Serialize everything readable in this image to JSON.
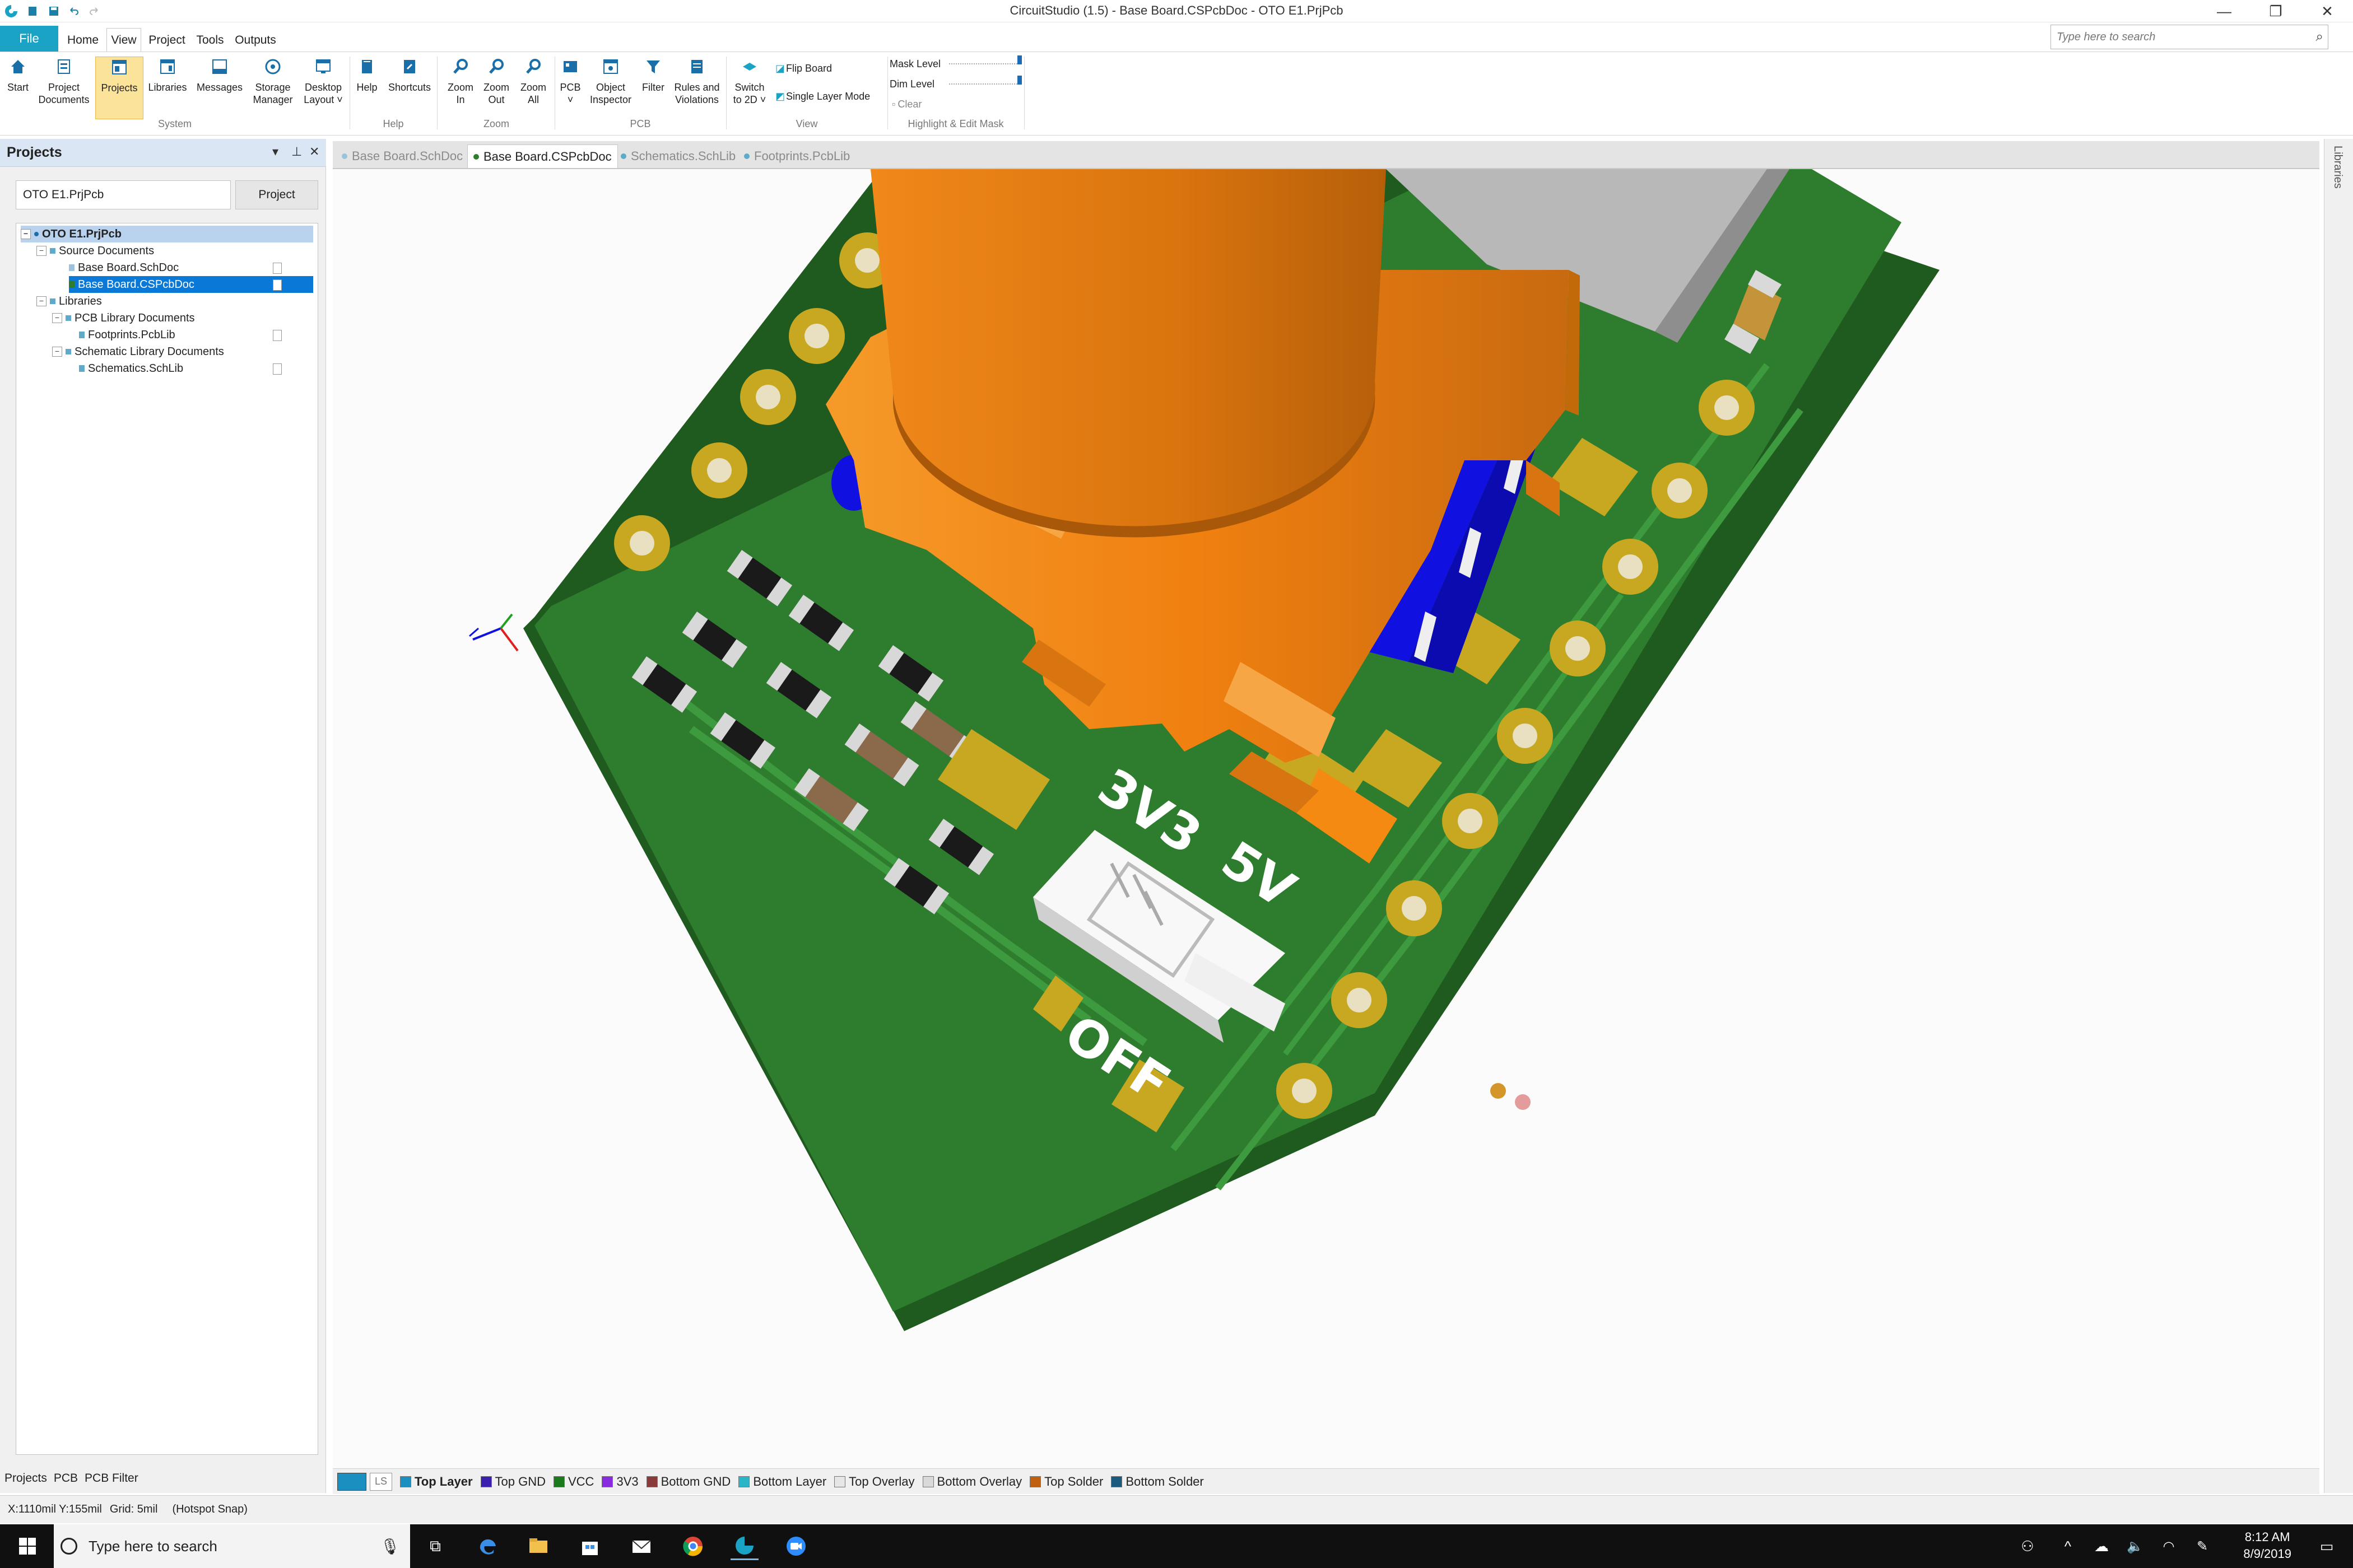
{
  "window": {
    "title": "CircuitStudio (1.5) - Base Board.CSPcbDoc - OTO E1.PrjPcb",
    "minimize": "—",
    "restore": "❐",
    "close": "✕"
  },
  "menu": {
    "file": "File",
    "tabs": [
      "Home",
      "View",
      "Project",
      "Tools",
      "Outputs"
    ],
    "active_tab": "View",
    "search_placeholder": "Type here to search"
  },
  "ribbon": {
    "buttons": [
      {
        "label": "Start",
        "icon": "home-icon"
      },
      {
        "label": "Project\nDocuments",
        "icon": "project-documents-icon"
      },
      {
        "label": "Projects",
        "icon": "projects-icon"
      },
      {
        "label": "Libraries",
        "icon": "libraries-icon"
      },
      {
        "label": "Messages",
        "icon": "messages-icon"
      },
      {
        "label": "Storage\nManager",
        "icon": "storage-manager-icon"
      },
      {
        "label": "Desktop\nLayout ˅",
        "icon": "desktop-layout-icon"
      },
      {
        "label": "Help",
        "icon": "help-icon"
      },
      {
        "label": "Shortcuts",
        "icon": "shortcuts-icon"
      },
      {
        "label": "Zoom\nIn",
        "icon": "zoom-in-icon"
      },
      {
        "label": "Zoom\nOut",
        "icon": "zoom-out-icon"
      },
      {
        "label": "Zoom\nAll",
        "icon": "zoom-all-icon"
      },
      {
        "label": "PCB\n˅",
        "icon": "pcb-icon"
      },
      {
        "label": "Object\nInspector",
        "icon": "object-inspector-icon"
      },
      {
        "label": "Filter",
        "icon": "filter-icon"
      },
      {
        "label": "Rules and\nViolations",
        "icon": "rules-violations-icon"
      },
      {
        "label": "Switch\nto 2D ˅",
        "icon": "switch-2d-icon"
      }
    ],
    "selected": "Projects",
    "groups": [
      "System",
      "Help",
      "Zoom",
      "PCB",
      "View",
      "Highlight & Edit Mask"
    ],
    "flip_board": "Flip Board",
    "single_layer_mode": "Single Layer Mode",
    "mask_level": "Mask Level",
    "dim_level": "Dim Level",
    "clear": "Clear",
    "mask_level_fraction": 1.0,
    "dim_level_fraction": 1.0
  },
  "projects_panel": {
    "title": "Projects",
    "field_value": "OTO E1.PrjPcb",
    "project_button": "Project",
    "tree": [
      {
        "label": "OTO E1.PrjPcb",
        "depth": 0,
        "kind": "project",
        "expander": "−"
      },
      {
        "label": "Source Documents",
        "depth": 1,
        "kind": "folder",
        "expander": "−"
      },
      {
        "label": "Base Board.SchDoc",
        "depth": 2,
        "kind": "doc"
      },
      {
        "label": "Base Board.CSPcbDoc",
        "depth": 2,
        "kind": "doc",
        "selected": true
      },
      {
        "label": "Libraries",
        "depth": 1,
        "kind": "folder",
        "expander": "−"
      },
      {
        "label": "PCB Library Documents",
        "depth": 2,
        "kind": "folder",
        "expander": "−"
      },
      {
        "label": "Footprints.PcbLib",
        "depth": 3,
        "kind": "doc"
      },
      {
        "label": "Schematic Library Documents",
        "depth": 2,
        "kind": "folder",
        "expander": "−"
      },
      {
        "label": "Schematics.SchLib",
        "depth": 3,
        "kind": "doc"
      }
    ],
    "bottom_tabs": [
      "Projects",
      "PCB",
      "PCB Filter"
    ]
  },
  "doc_tabs": [
    {
      "label": "Base Board.SchDoc",
      "active": false
    },
    {
      "label": "Base Board.CSPcbDoc",
      "active": true
    },
    {
      "label": "Schematics.SchLib",
      "active": false
    },
    {
      "label": "Footprints.PcbLib",
      "active": false
    }
  ],
  "right_panel_label": "Libraries",
  "board": {
    "silk_3v3": "3V3",
    "silk_5v": "5V",
    "silk_off": "OFF"
  },
  "layers": {
    "ls_label": "LS",
    "items": [
      {
        "name": "Top Layer",
        "color": "#1a8fc0",
        "active": true
      },
      {
        "name": "Top GND",
        "color": "#3b1fb0"
      },
      {
        "name": "VCC",
        "color": "#1b7a1b"
      },
      {
        "name": "3V3",
        "color": "#8a2be2"
      },
      {
        "name": "Bottom GND",
        "color": "#8b3a3a"
      },
      {
        "name": "Bottom Layer",
        "color": "#2ab5c8"
      },
      {
        "name": "Top Overlay",
        "color": "#e6e6e6"
      },
      {
        "name": "Bottom Overlay",
        "color": "#d9d9d9"
      },
      {
        "name": "Top Solder",
        "color": "#c06010"
      },
      {
        "name": "Bottom Solder",
        "color": "#1d5a80"
      }
    ]
  },
  "status": {
    "coords": "X:1110mil Y:155mil",
    "grid": "Grid: 5mil",
    "snap": "(Hotspot Snap)"
  },
  "taskbar": {
    "search_placeholder": "Type here to search",
    "time": "8:12 AM",
    "date": "8/9/2019"
  },
  "colors": {
    "accent": "#1aa3c5",
    "pcb_green": "#2e7d2e",
    "component_orange": "#f58a12",
    "pad_gold": "#c8a820"
  }
}
